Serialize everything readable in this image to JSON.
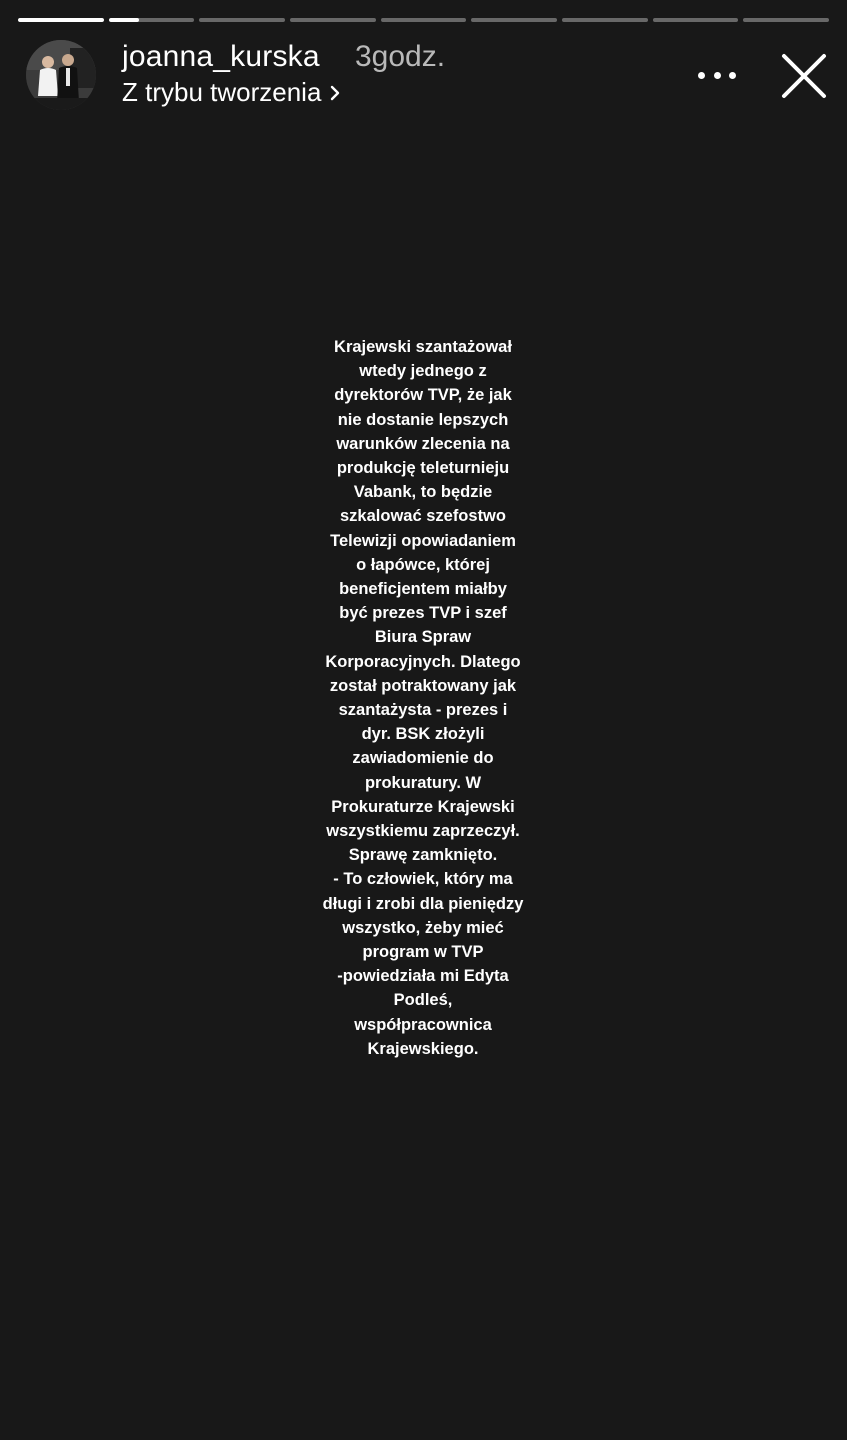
{
  "story": {
    "progress_segments": [
      {
        "fill": 1.0
      },
      {
        "fill": 0.35
      },
      {
        "fill": 0
      },
      {
        "fill": 0
      },
      {
        "fill": 0
      },
      {
        "fill": 0
      },
      {
        "fill": 0
      },
      {
        "fill": 0
      },
      {
        "fill": 0
      }
    ],
    "header": {
      "username": "joanna_kurska",
      "time_ago": "3godz.",
      "subtitle": "Z trybu tworzenia",
      "subtitle_icon": "chevron-right-icon",
      "more_icon": "more-horizontal-icon",
      "close_icon": "close-icon",
      "avatar": "profile-photo"
    },
    "text_lines": [
      "Krajewski szantażował",
      "wtedy jednego z",
      "dyrektorów TVP, że jak",
      "nie dostanie lepszych",
      "warunków zlecenia na",
      "produkcję teleturnieju",
      "Vabank, to będzie",
      "szkalować szefostwo",
      "Telewizji opowiadaniem",
      "o łapówce, której",
      "beneficjentem miałby",
      "być prezes TVP i szef",
      "Biura Spraw",
      "Korporacyjnych. Dlatego",
      "został potraktowany jak",
      "szantażysta - prezes i",
      "dyr. BSK złożyli",
      "zawiadomienie do",
      "prokuratury. W",
      "Prokuraturze Krajewski",
      "wszystkiemu zaprzeczył.",
      "Sprawę zamknięto.",
      "- To człowiek, który ma",
      "długi i zrobi dla pieniędzy",
      "wszystko, żeby mieć",
      "program w TVP",
      "-powiedziała mi Edyta",
      "Podleś,",
      "współpracownica",
      "Krajewskiego."
    ],
    "colors": {
      "background": "#181818",
      "text": "#ffffff",
      "muted": "#b9b9b9"
    }
  }
}
